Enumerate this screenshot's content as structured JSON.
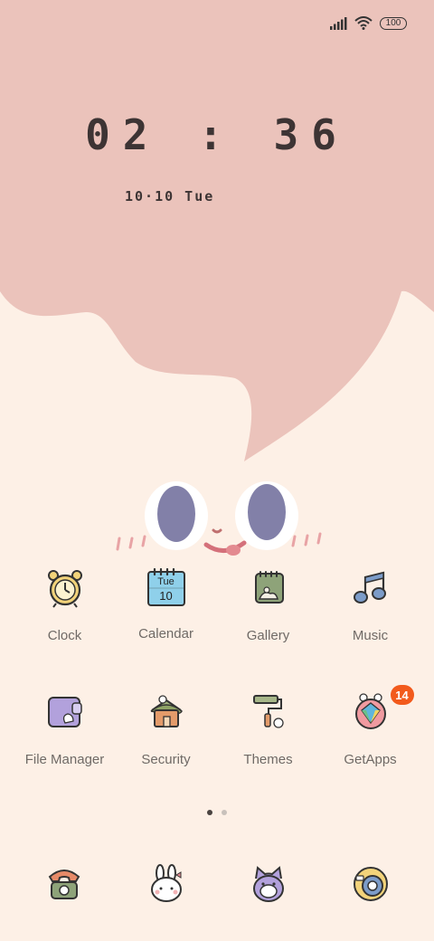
{
  "status_bar": {
    "battery": "100"
  },
  "clock": {
    "time": "02 : 36",
    "date": "10·10 Tue"
  },
  "apps": [
    {
      "label": "Clock",
      "icon": "alarm-clock-icon"
    },
    {
      "label": "Calendar",
      "icon": "calendar-icon",
      "day": "Tue",
      "date": "10"
    },
    {
      "label": "Gallery",
      "icon": "gallery-icon"
    },
    {
      "label": "Music",
      "icon": "music-note-icon"
    },
    {
      "label": "File Manager",
      "icon": "folder-wallet-icon"
    },
    {
      "label": "Security",
      "icon": "house-shield-icon"
    },
    {
      "label": "Themes",
      "icon": "paint-roller-icon"
    },
    {
      "label": "GetApps",
      "icon": "shopping-bag-icon",
      "badge": "14"
    }
  ],
  "page_indicator": {
    "pages": 2,
    "active": 1
  },
  "dock": [
    {
      "icon": "phone-icon"
    },
    {
      "icon": "bunny-messages-icon"
    },
    {
      "icon": "cat-browser-icon"
    },
    {
      "icon": "camera-icon"
    }
  ],
  "colors": {
    "wallpaper_top": "#ebc3bb",
    "wallpaper_bottom": "#fdf0e6",
    "accent": "#f25a1c",
    "eye": "#8280a8"
  }
}
